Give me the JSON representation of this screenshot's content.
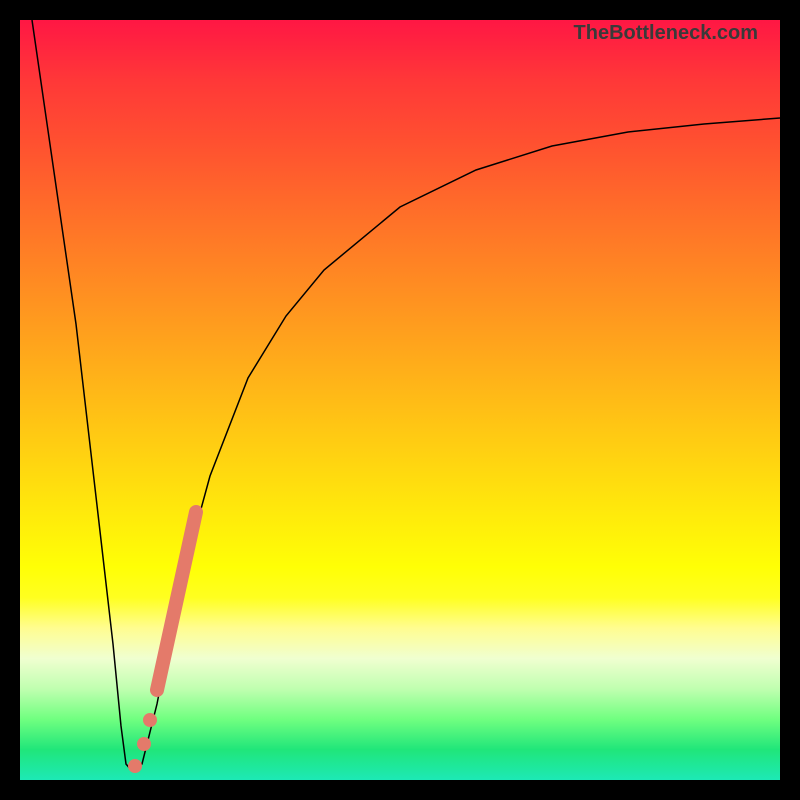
{
  "attribution": "TheBottleneck.com",
  "chart_data": {
    "type": "line",
    "title": "",
    "xlabel": "",
    "ylabel": "",
    "xlim": [
      0,
      100
    ],
    "ylim": [
      0,
      100
    ],
    "grid": false,
    "background": "spectral-gradient-red-to-green",
    "series": [
      {
        "name": "bottleneck-curve",
        "color": "#000000",
        "x": [
          1,
          3,
          5,
          7,
          9,
          11,
          13,
          15,
          18,
          21,
          25,
          30,
          35,
          40,
          50,
          60,
          70,
          80,
          90,
          100
        ],
        "y": [
          100,
          80,
          60,
          40,
          20,
          4,
          0,
          4,
          20,
          35,
          50,
          62,
          70,
          76,
          83,
          87,
          90,
          91.5,
          92.5,
          93
        ]
      }
    ],
    "highlights": [
      {
        "type": "segment",
        "x_start": 15,
        "x_end": 21,
        "y_start": 4,
        "y_end": 40,
        "color": "#e47a6a",
        "width": 14
      },
      {
        "type": "dot",
        "x": 14.5,
        "y": 5,
        "r": 7,
        "color": "#e47a6a"
      },
      {
        "type": "dot",
        "x": 16,
        "y": 12,
        "r": 7,
        "color": "#e47a6a"
      },
      {
        "type": "dot",
        "x": 17,
        "y": 18,
        "r": 7,
        "color": "#e47a6a"
      }
    ],
    "minimum_point": {
      "x": 12,
      "y": 0
    }
  }
}
